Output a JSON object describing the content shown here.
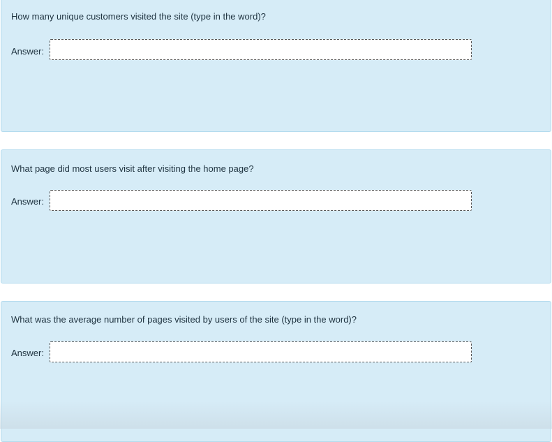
{
  "questions": [
    {
      "text": "How many unique customers visited the site (type in the word)?",
      "answer_label": "Answer:",
      "answer_value": ""
    },
    {
      "text": "What page did most users visit after visiting the home page?",
      "answer_label": "Answer:",
      "answer_value": ""
    },
    {
      "text": "What was the average number of pages visited by users of the site (type in the word)?",
      "answer_label": "Answer:",
      "answer_value": ""
    }
  ]
}
